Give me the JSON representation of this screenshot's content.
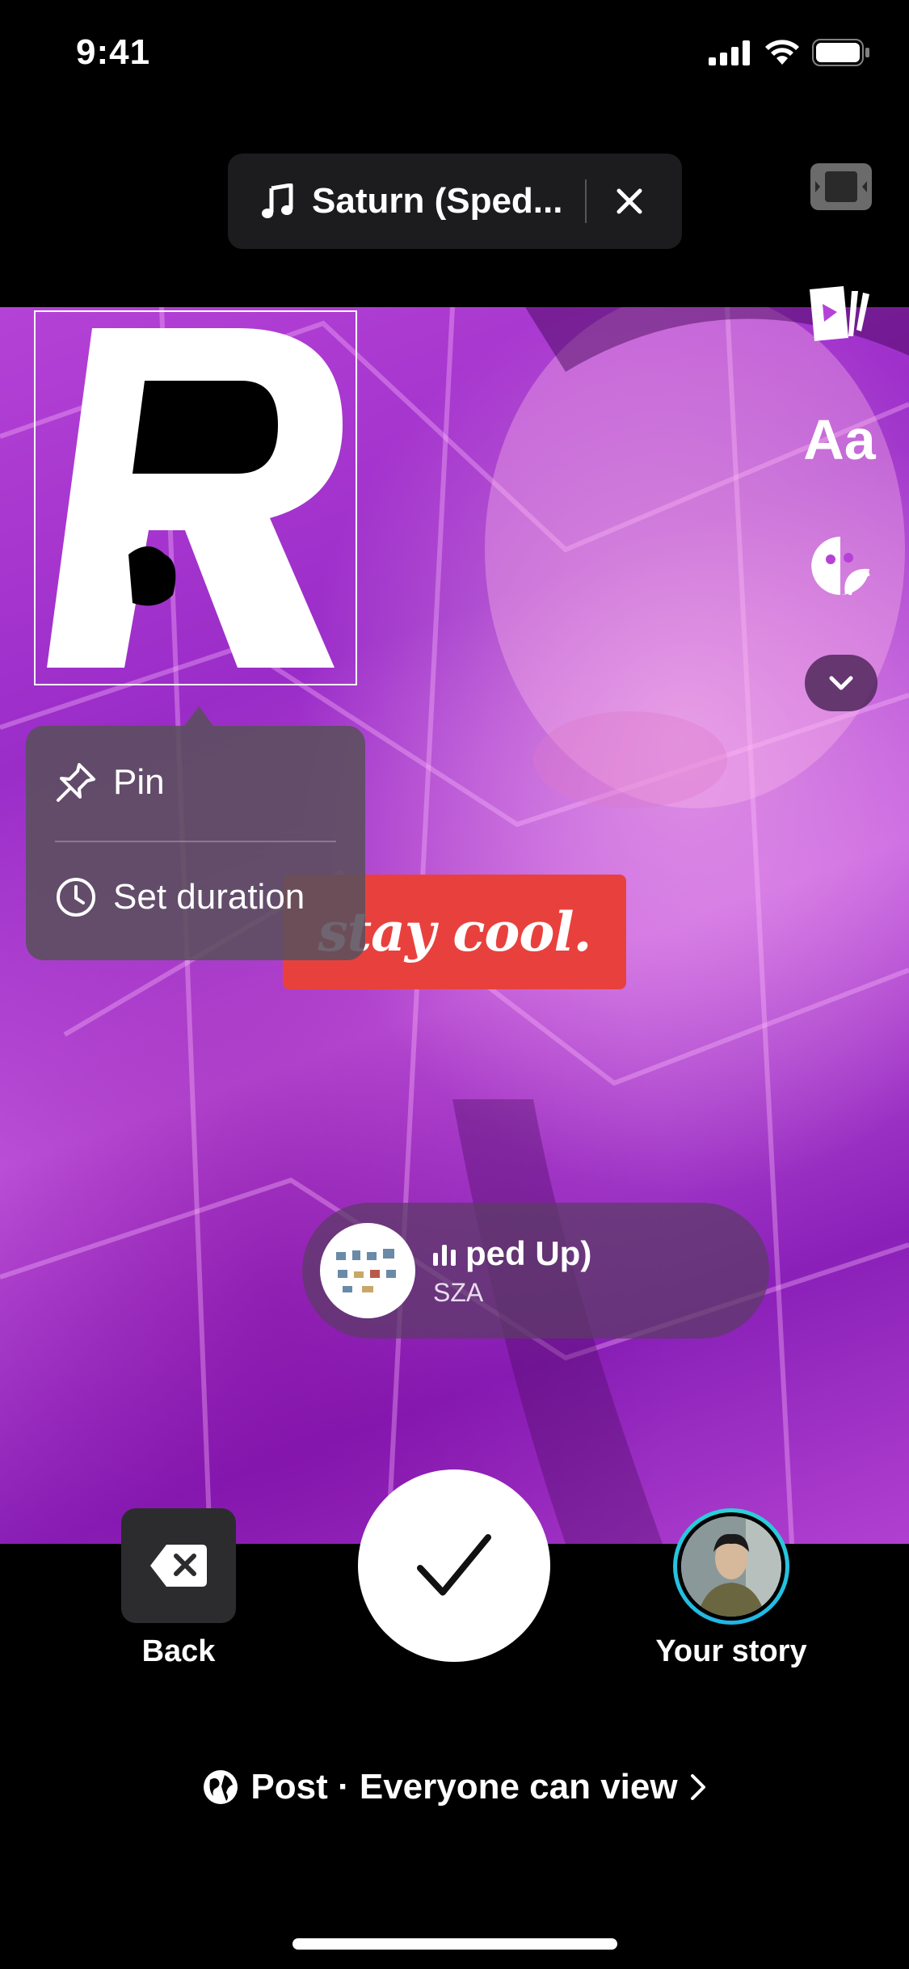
{
  "status_bar": {
    "time": "9:41"
  },
  "sound": {
    "title": "Saturn (Sped..."
  },
  "popup": {
    "pin_label": "Pin",
    "duration_label": "Set duration"
  },
  "stickers": {
    "text_sticker": "stay cool.",
    "r_letter": "R"
  },
  "music_sticker": {
    "title": "ped Up)",
    "artist": "SZA"
  },
  "toolbar": {
    "text_tool": "Aa"
  },
  "bottom": {
    "back_label": "Back",
    "story_label": "Your story",
    "post_label": "Post · Everyone can view"
  },
  "colors": {
    "accent_red": "#e8413d",
    "story_ring": "#2fd0d6",
    "video_purple": "#b542d6"
  }
}
